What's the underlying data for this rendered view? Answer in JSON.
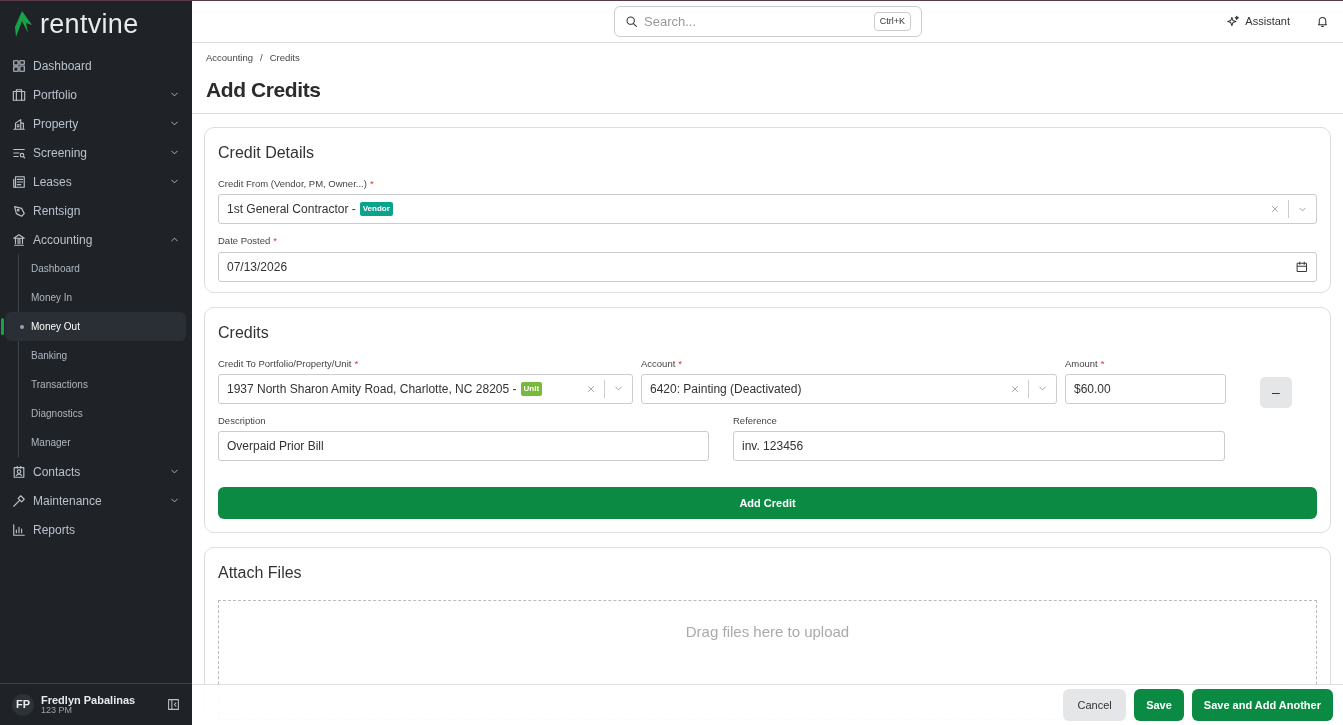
{
  "sidebar": {
    "logo": "rentvine",
    "items": [
      {
        "label": "Dashboard",
        "kind": "link"
      },
      {
        "label": "Portfolio",
        "kind": "group",
        "expanded": false
      },
      {
        "label": "Property",
        "kind": "group",
        "expanded": false
      },
      {
        "label": "Screening",
        "kind": "group",
        "expanded": false
      },
      {
        "label": "Leases",
        "kind": "group",
        "expanded": false
      },
      {
        "label": "Rentsign",
        "kind": "link"
      },
      {
        "label": "Accounting",
        "kind": "group",
        "expanded": true,
        "children": [
          {
            "label": "Dashboard",
            "selected": false
          },
          {
            "label": "Money In",
            "selected": false
          },
          {
            "label": "Money Out",
            "selected": true
          },
          {
            "label": "Banking",
            "selected": false
          },
          {
            "label": "Transactions",
            "selected": false
          },
          {
            "label": "Diagnostics",
            "selected": false
          },
          {
            "label": "Manager",
            "selected": false
          }
        ]
      },
      {
        "label": "Contacts",
        "kind": "group",
        "expanded": false
      },
      {
        "label": "Maintenance",
        "kind": "group",
        "expanded": false
      },
      {
        "label": "Reports",
        "kind": "link"
      }
    ],
    "user": {
      "initials": "FP",
      "name": "Fredlyn Pabalinas",
      "subtitle": "123 PM"
    }
  },
  "topbar": {
    "search": {
      "placeholder": "Search...",
      "shortcut": "Ctrl+K"
    },
    "assistant": "Assistant"
  },
  "breadcrumb": [
    "Accounting",
    "Credits"
  ],
  "breadcrumb_separator": "/",
  "title": "Add Credits",
  "credit_details": {
    "title": "Credit Details",
    "fields": [
      {
        "label": "Credit From (Vendor, PM, Owner...)",
        "required_mark": "*",
        "kind": "select",
        "value": "1st General Contractor - ",
        "tag": {
          "text": "Vendor",
          "color": "#0ba38e"
        }
      },
      {
        "label": "Date Posted",
        "required_mark": "*",
        "kind": "date",
        "value": "07/13/2026"
      }
    ]
  },
  "credits": {
    "title": "Credits",
    "fields": [
      {
        "label": "Credit To Portfolio/Property/Unit",
        "required_mark": "*",
        "kind": "select",
        "value": "1937 North Sharon Amity Road, Charlotte, NC 28205 - ",
        "tag": {
          "text": "Unit",
          "color": "#78b83c"
        }
      },
      {
        "label": "Account",
        "required_mark": "*",
        "kind": "select",
        "value": "6420: Painting (Deactivated)"
      },
      {
        "label": "Amount",
        "required_mark": "*",
        "kind": "text",
        "value": "$60.00"
      },
      {
        "label": "Description",
        "kind": "text",
        "value": "Overpaid Prior Bill"
      },
      {
        "label": "Reference",
        "kind": "text",
        "value": "inv. 123456"
      }
    ],
    "remove": "–",
    "add_button": "Add Credit"
  },
  "attach": {
    "title": "Attach Files",
    "drop_text": "Drag files here to upload"
  },
  "footer": [
    {
      "label": "Cancel",
      "kind": "secondary"
    },
    {
      "label": "Save",
      "kind": "primary"
    },
    {
      "label": "Save and Add Another",
      "kind": "primary"
    }
  ]
}
